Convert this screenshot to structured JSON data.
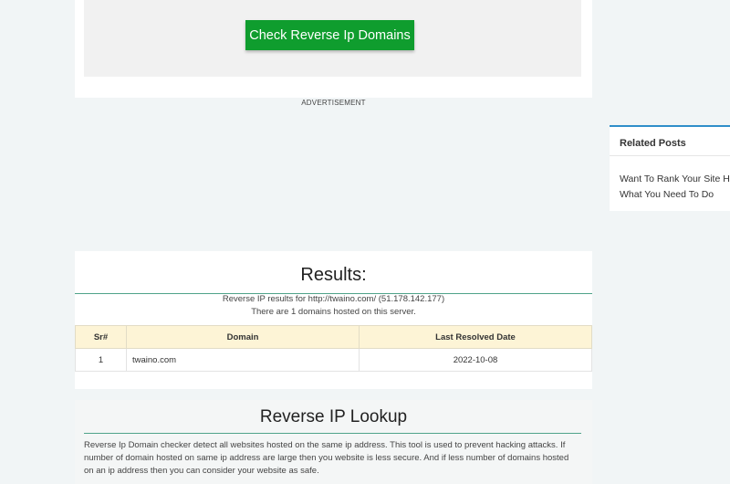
{
  "tool": {
    "check_button_label": "Check Reverse Ip Domains"
  },
  "advertisement": {
    "label": "ADVERTISEMENT"
  },
  "results": {
    "title": "Results:",
    "summary_line1": "Reverse IP results for http://twaino.com/ (51.178.142.177)",
    "summary_line2": "There are 1 domains hosted on this server.",
    "table": {
      "headers": [
        "Sr#",
        "Domain",
        "Last Resolved Date"
      ],
      "rows": [
        {
          "sr": "1",
          "domain": "twaino.com",
          "date": "2022-10-08"
        }
      ]
    }
  },
  "lookup": {
    "title": "Reverse IP Lookup",
    "description": "Reverse Ip Domain checker detect all websites hosted on the same ip address. This tool is used to prevent hacking attacks. If number of domain hosted on same ip address are large then you website is less secure. And if less number of domains hosted on an ip address then you can consider your website as safe."
  },
  "sidebar": {
    "related_title": "Related Posts",
    "related_link": "Want To Rank Your Site Hi Is What You Need To Do"
  },
  "colors": {
    "button_green": "#0f9d2e",
    "accent_line": "#4fa38a",
    "sidebar_accent": "#2f8ec9"
  }
}
